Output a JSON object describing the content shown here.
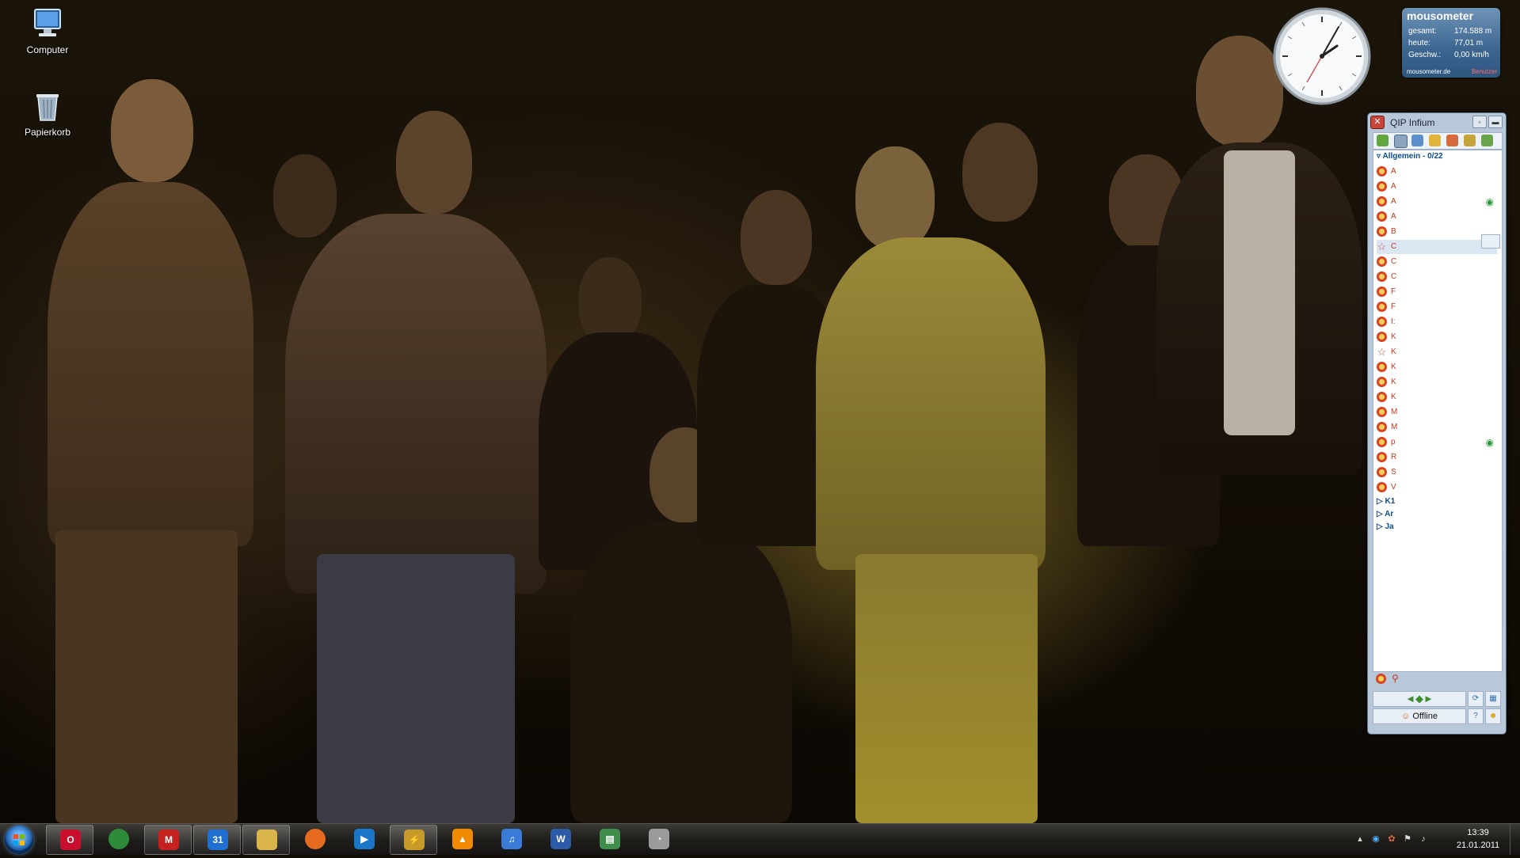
{
  "desktop": {
    "icons": [
      {
        "label": "Computer",
        "icon": "computer-icon"
      },
      {
        "label": "Papierkorb",
        "icon": "recycle-bin-icon"
      }
    ]
  },
  "mousometer": {
    "title": "mousometer",
    "rows": [
      {
        "key": "gesamt:",
        "value": "174.588 m"
      },
      {
        "key": "heute:",
        "value": "77,01 m"
      },
      {
        "key": "Geschw.:",
        "value": "0,00 km/h"
      }
    ],
    "footer": "mousometer.de",
    "user_link": "Benutzer"
  },
  "qip": {
    "title": "QIP Infium",
    "group_main": "Allgemein - 0/22",
    "contacts": [
      {
        "name": "A",
        "icon": "flower",
        "eye": false
      },
      {
        "name": "A",
        "icon": "flower",
        "eye": false
      },
      {
        "name": "A",
        "icon": "flower",
        "eye": true
      },
      {
        "name": "A",
        "icon": "flower",
        "eye": false
      },
      {
        "name": "B",
        "icon": "flower",
        "eye": false
      },
      {
        "name": "C",
        "icon": "star",
        "eye": false
      },
      {
        "name": "C",
        "icon": "flower",
        "eye": false
      },
      {
        "name": "C",
        "icon": "flower",
        "eye": false
      },
      {
        "name": "F",
        "icon": "flower",
        "eye": false
      },
      {
        "name": "F",
        "icon": "flower",
        "eye": false
      },
      {
        "name": "I:",
        "icon": "flower",
        "eye": false
      },
      {
        "name": "K",
        "icon": "flower",
        "eye": false
      },
      {
        "name": "K",
        "icon": "star",
        "eye": false
      },
      {
        "name": "K",
        "icon": "flower",
        "eye": false
      },
      {
        "name": "K",
        "icon": "flower",
        "eye": false
      },
      {
        "name": "K",
        "icon": "flower",
        "eye": false
      },
      {
        "name": "M",
        "icon": "flower",
        "eye": false
      },
      {
        "name": "M",
        "icon": "flower",
        "eye": false
      },
      {
        "name": "p",
        "icon": "flower",
        "eye": true
      },
      {
        "name": "R",
        "icon": "flower",
        "eye": false
      },
      {
        "name": "S",
        "icon": "flower",
        "eye": false
      },
      {
        "name": "V",
        "icon": "flower",
        "eye": false
      }
    ],
    "groups_collapsed": [
      "K1",
      "Ar",
      "Ja"
    ],
    "status": "Offline"
  },
  "taskbar": {
    "apps": [
      {
        "name": "opera",
        "icon": "opera-icon",
        "glyph": "O",
        "color": "#c8102e",
        "active": true
      },
      {
        "name": "chrome",
        "icon": "chrome-icon",
        "glyph": "",
        "color": "#2e8b3a",
        "active": false
      },
      {
        "name": "gmail",
        "icon": "gmail-icon",
        "glyph": "M",
        "color": "#c5221f",
        "active": true
      },
      {
        "name": "calendar",
        "icon": "calendar-icon",
        "glyph": "31",
        "color": "#1f6fd1",
        "active": true
      },
      {
        "name": "explorer",
        "icon": "folder-icon",
        "glyph": "",
        "color": "#d9b44a",
        "active": true
      },
      {
        "name": "firefox",
        "icon": "firefox-icon",
        "glyph": "",
        "color": "#e66a1f",
        "active": false
      },
      {
        "name": "media-player",
        "icon": "media-player-icon",
        "glyph": "▶",
        "color": "#1a76c9",
        "active": false
      },
      {
        "name": "winamp",
        "icon": "winamp-icon",
        "glyph": "⚡",
        "color": "#c89a2a",
        "active": true
      },
      {
        "name": "vlc",
        "icon": "vlc-icon",
        "glyph": "▲",
        "color": "#f08a00",
        "active": false
      },
      {
        "name": "itunes",
        "icon": "itunes-icon",
        "glyph": "♫",
        "color": "#3b7bd8",
        "active": false
      },
      {
        "name": "word",
        "icon": "word-icon",
        "glyph": "W",
        "color": "#2b5aa6",
        "active": false
      },
      {
        "name": "monitor",
        "icon": "monitor-icon",
        "glyph": "▤",
        "color": "#3f8d4a",
        "active": false
      },
      {
        "name": "speedometer",
        "icon": "gauge-icon",
        "glyph": "◔",
        "color": "#9a9a9a",
        "active": false
      }
    ],
    "time": "13:39",
    "date": "21.01.2011"
  }
}
